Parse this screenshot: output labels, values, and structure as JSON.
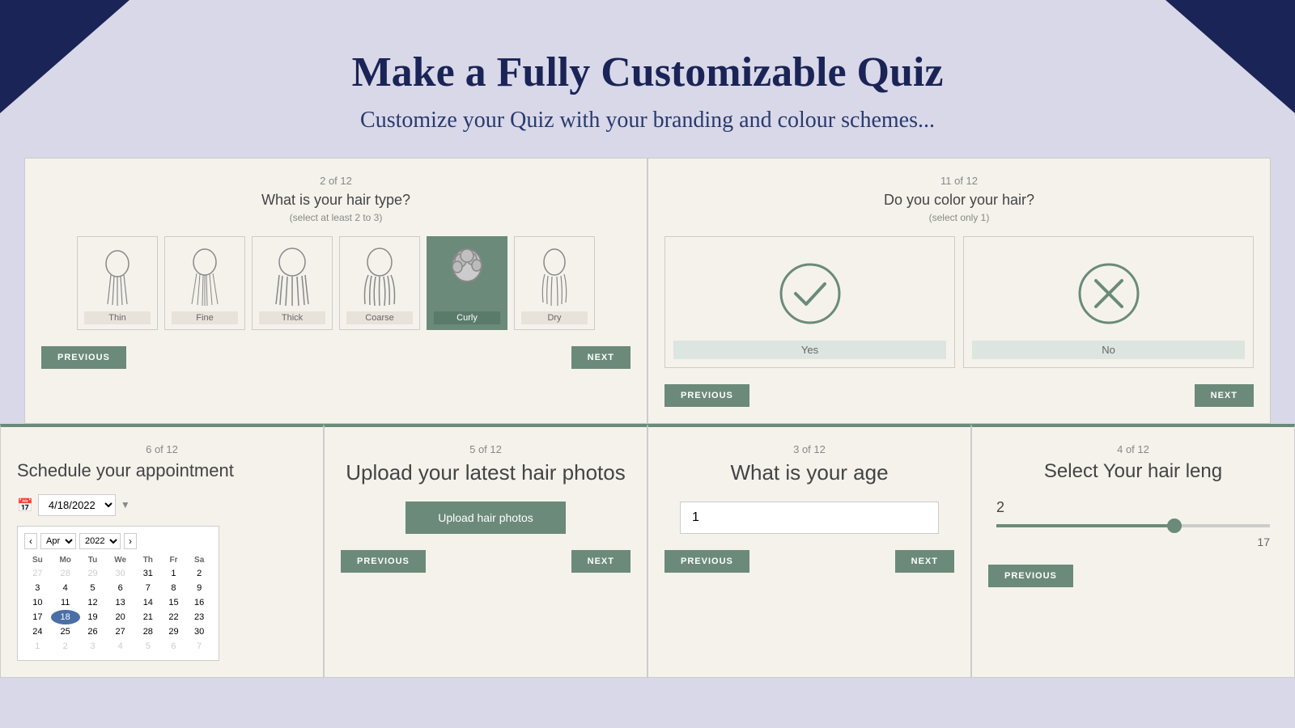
{
  "header": {
    "title": "Make a Fully Customizable Quiz",
    "subtitle": "Customize your Quiz with your branding and colour schemes..."
  },
  "quiz1": {
    "progress": "2 of 12",
    "question": "What is your hair type?",
    "hint": "(select at least 2 to 3)",
    "options": [
      {
        "label": "Thin",
        "selected": false
      },
      {
        "label": "Fine",
        "selected": false
      },
      {
        "label": "Thick",
        "selected": false
      },
      {
        "label": "Coarse",
        "selected": false
      },
      {
        "label": "Curly",
        "selected": true
      },
      {
        "label": "Dry",
        "selected": false
      }
    ],
    "prev": "PREVIOUS",
    "next": "NEXT"
  },
  "quiz2": {
    "progress": "11 of 12",
    "question": "Do you color your hair?",
    "hint": "(select only 1)",
    "options": [
      {
        "label": "Yes",
        "icon": "✓"
      },
      {
        "label": "No",
        "icon": "✕"
      }
    ],
    "prev": "PREVIOUS",
    "next": "NEXT"
  },
  "quiz3": {
    "progress": "6 of 12",
    "title": "Schedule your appointment",
    "date": "4/18/2022",
    "month": "Apr",
    "year": "2022",
    "days_header": [
      "Su",
      "Mo",
      "Tu",
      "We",
      "Th",
      "Fr",
      "Sa"
    ],
    "weeks": [
      [
        "27",
        "28",
        "29",
        "30",
        "31",
        "1",
        "2"
      ],
      [
        "3",
        "4",
        "5",
        "6",
        "7",
        "8",
        "9"
      ],
      [
        "10",
        "11",
        "12",
        "13",
        "14",
        "15",
        "16"
      ],
      [
        "17",
        "18",
        "19",
        "20",
        "21",
        "22",
        "23"
      ],
      [
        "24",
        "25",
        "26",
        "27",
        "28",
        "29",
        "30"
      ],
      [
        "1",
        "2",
        "3",
        "4",
        "5",
        "6",
        "7"
      ]
    ],
    "today_cell": "18"
  },
  "quiz4": {
    "progress": "5 of 12",
    "title": "Upload your latest hair photos",
    "upload_btn": "Upload hair photos",
    "prev": "PREVIOUS",
    "next": "NEXT"
  },
  "quiz5": {
    "progress": "3 of 12",
    "title": "What is your age",
    "placeholder": "1",
    "prev": "PREVIOUS",
    "next": "NEXT"
  },
  "quiz6": {
    "progress": "4 of 12",
    "title": "Select Your hair leng",
    "slider_value": "2",
    "slider_max": "17",
    "slider_pct": 65,
    "prev": "PREVIOUS"
  }
}
